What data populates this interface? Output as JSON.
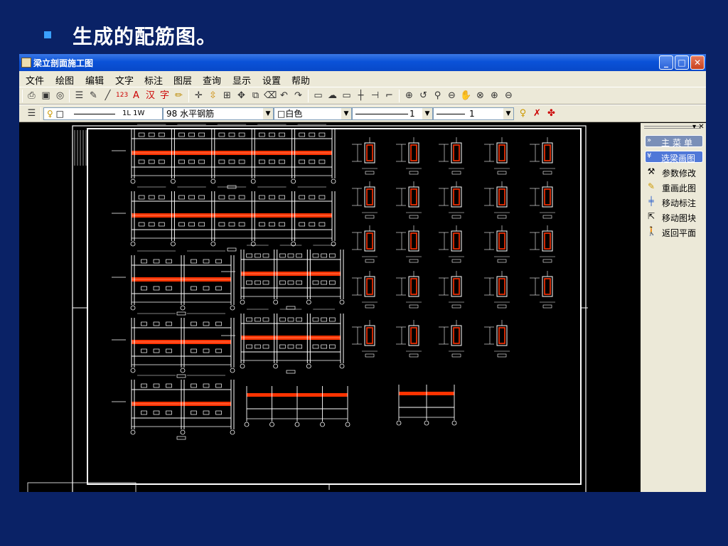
{
  "slide": {
    "title": "生成的配筋图。"
  },
  "window": {
    "title": "梁立剖面施工图",
    "buttons": {
      "minimize": "_",
      "maximize": "□",
      "close": "✕"
    }
  },
  "menu": [
    "文件",
    "绘图",
    "编辑",
    "文字",
    "标注",
    "图层",
    "查询",
    "显示",
    "设置",
    "帮助"
  ],
  "toolbar2": {
    "layer_width_label": "1L 1W",
    "layer_name": "98 水平钢筋",
    "color": "白色",
    "linetype_value": "1",
    "lineweight_value": "1"
  },
  "side_panel": {
    "main_menu": "主菜单",
    "selected_menu": "选梁画图",
    "items": [
      {
        "label": "参数修改",
        "icon": "wrench-icon"
      },
      {
        "label": "重画此图",
        "icon": "pencil-icon"
      },
      {
        "label": "移动标注",
        "icon": "move-label-icon"
      },
      {
        "label": "移动图块",
        "icon": "move-block-icon"
      },
      {
        "label": "返回平面",
        "icon": "walk-icon"
      }
    ]
  },
  "colors": {
    "slide_bg": "#0a2266",
    "drawing_lines": "#ffffff",
    "rebar": "#ff3300",
    "canvas_bg": "#000000"
  }
}
